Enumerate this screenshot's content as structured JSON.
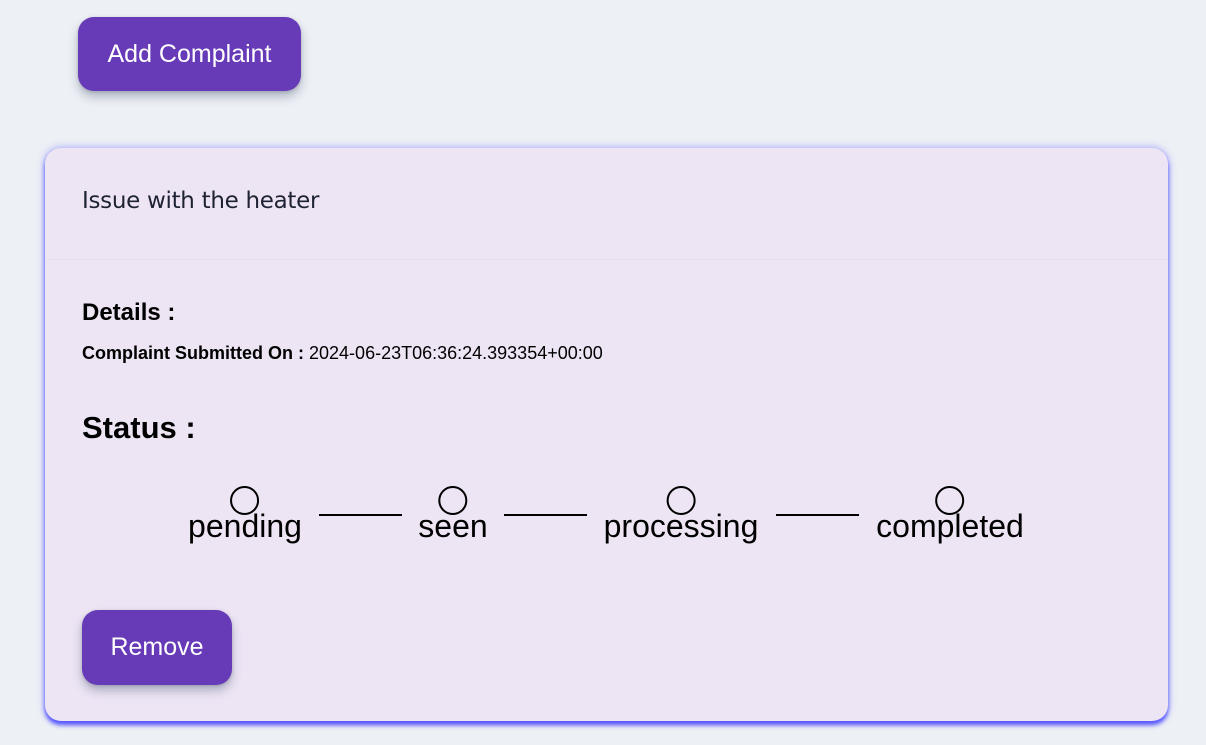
{
  "toolbar": {
    "add_label": "Add Complaint"
  },
  "complaint": {
    "title": "Issue with the heater",
    "details_heading": "Details :",
    "submitted_label": "Complaint Submitted On :",
    "submitted_value": "2024-06-23T06:36:24.393354+00:00",
    "status_heading": "Status :",
    "steps": [
      {
        "label": "pending"
      },
      {
        "label": "seen"
      },
      {
        "label": "processing"
      },
      {
        "label": "completed"
      }
    ],
    "remove_label": "Remove"
  },
  "colors": {
    "page_background": "#edf0f5",
    "card_background": "#ede5f4",
    "button_background": "#673ab7",
    "button_text": "#ffffff",
    "card_glow": "#5a5aff"
  }
}
